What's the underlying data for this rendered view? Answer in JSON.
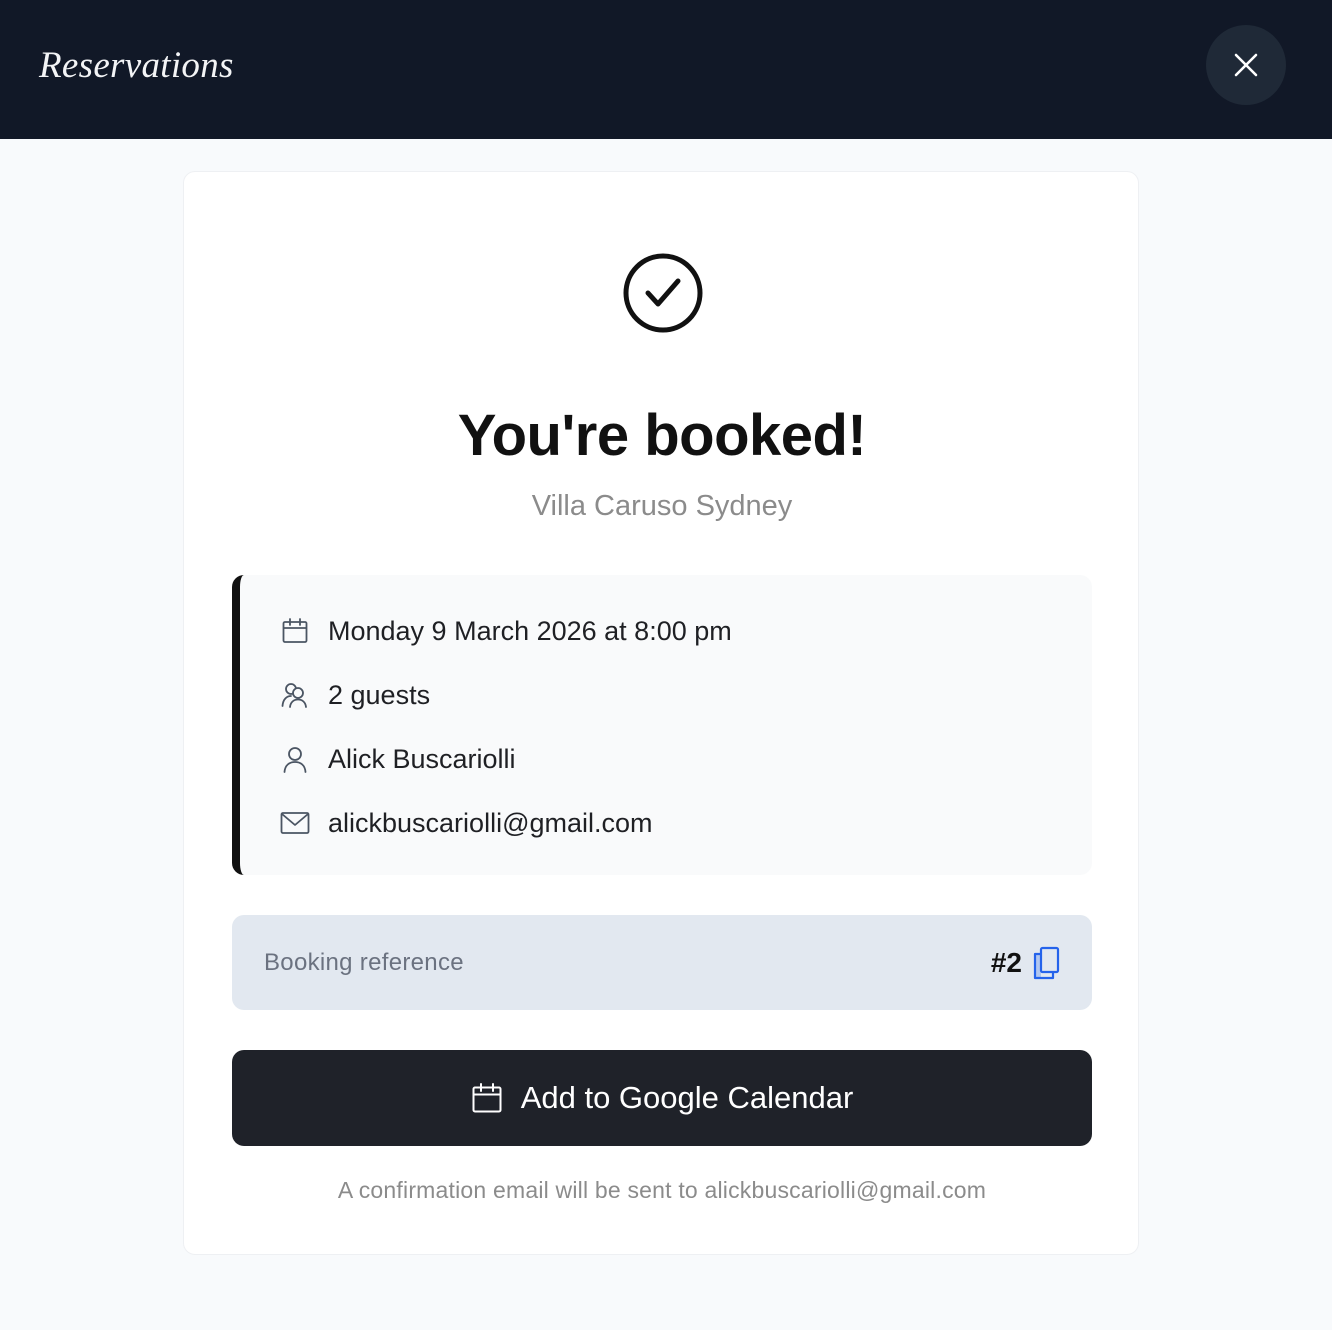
{
  "header": {
    "brand": "Reservations",
    "close_icon": "close-icon"
  },
  "confirmation": {
    "status_icon": "check-circle-icon",
    "title": "You're booked!",
    "venue": "Villa Caruso Sydney"
  },
  "details": {
    "datetime": "Monday 9 March 2026 at 8:00 pm",
    "guests": "2 guests",
    "name": "Alick Buscariolli",
    "email": "alickbuscariolli@gmail.com",
    "icons": [
      "calendar-icon",
      "guests-icon",
      "person-icon",
      "mail-icon"
    ]
  },
  "booking_reference": {
    "label": "Booking reference",
    "value": "#2",
    "copy_icon": "copy-icon"
  },
  "actions": {
    "add_calendar_label": "Add to Google Calendar",
    "calendar_icon": "calendar-icon"
  },
  "footer_note": "A confirmation email will be sent to alickbuscariolli@gmail.com",
  "colors": {
    "header_bg": "#111827",
    "page_bg": "#f8fafc",
    "accent_bar": "#111111",
    "button_bg": "#1f2229",
    "copy_icon": "#2563eb",
    "reference_bg": "#e2e8f0"
  }
}
